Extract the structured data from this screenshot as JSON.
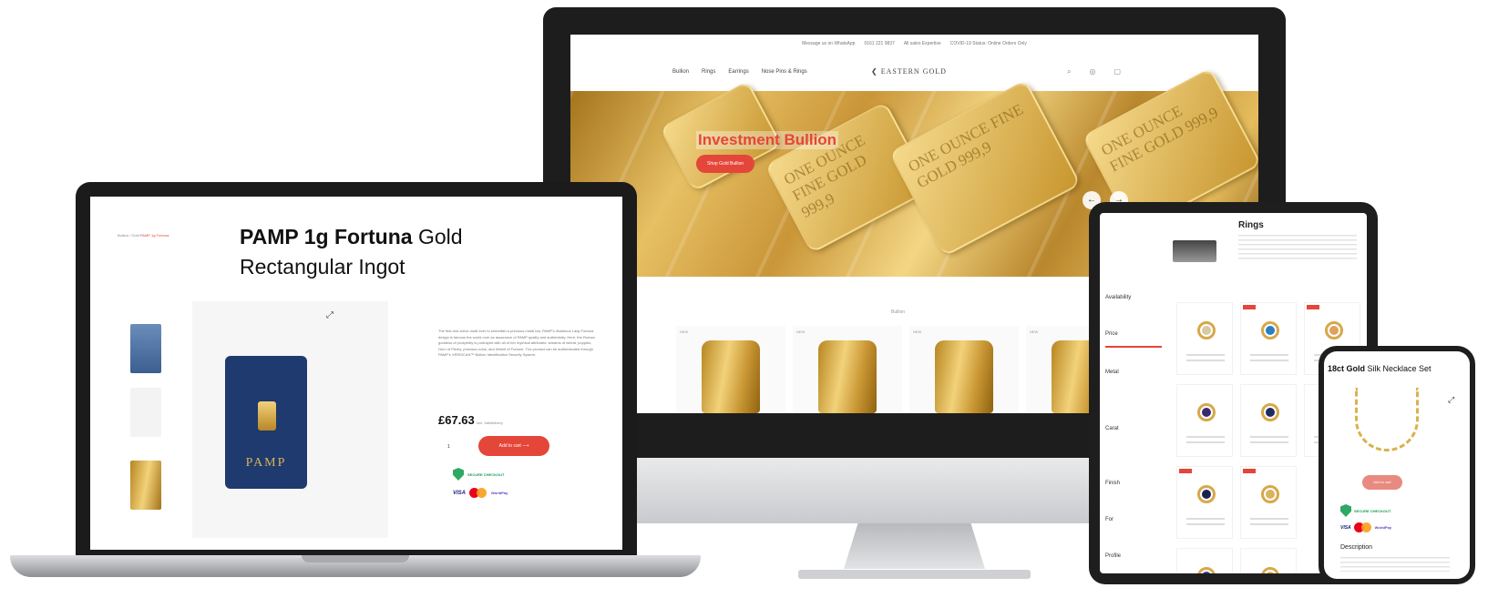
{
  "imac": {
    "topbar": [
      "Message us on WhatsApp",
      "0161 221 9837",
      "All sales Expertise",
      "COVID-19 Status: Online Orders Only"
    ],
    "nav_links": [
      "Bullion",
      "Rings",
      "Earrings",
      "Nose Pins & Rings"
    ],
    "logo": "EASTERN GOLD",
    "nav_icons": [
      "search-icon",
      "user-icon",
      "bag-icon"
    ],
    "hero_title": "Investment Bullion",
    "hero_button": "Shop Gold Bullion",
    "prev_arrow": "←",
    "next_arrow": "→",
    "bar_text": "ONE OUNCE FINE GOLD 999,9",
    "section_label": "Bullion",
    "card_tags": [
      "NEW",
      "NEW",
      "NEW",
      "NEW"
    ]
  },
  "laptop": {
    "breadcrumb_home": "Bullion / Gold",
    "breadcrumb_current": "PAMP 1g Fortuna",
    "title_bold": "PAMP 1g Fortuna",
    "title_rest": " Gold",
    "title_line2": "Rectangular Ingot",
    "expand_icon": "⤢",
    "pamp_brand": "PAMP",
    "description": "The first and arrive-motif ever to embellish a precious metal bar, PAMP's illustrious Lady Fortuna design is famous the world over as assurance of PAMP quality and authenticity. Here, the Roman goddess of prosperity is portrayed with all of her mythical attributes: streams of wheat, poppies, Horn of Plenty, precious coins, and Wheel of Fortune. The product can be authenticated through PAMP's VERISCAN™ Bullion Identification Security System.",
    "price": "£67.63",
    "price_note": "Incl. Vat/delivery",
    "qty": "1",
    "add_to_cart": "Add to cart  ⟶",
    "secure": "SECURE CHECKOUT",
    "pay_visa": "VISA",
    "pay_wp": "WorldPay"
  },
  "tablet": {
    "title": "Rings",
    "filters": {
      "availability": "Availability",
      "price": "Price",
      "metal": "Metal",
      "carat": "Carat",
      "finish": "Finish",
      "for": "For",
      "profile": "Profile"
    }
  },
  "phone": {
    "title_bold": "18ct Gold",
    "title_rest": " Silk Necklace Set",
    "expand_icon": "⤢",
    "button": "Add to cart",
    "secure": "SECURE CHECKOUT",
    "pay_visa": "VISA",
    "pay_wp": "WorldPay",
    "description": "Description"
  },
  "colors": {
    "accent": "#e4463a",
    "gold": "#e7c064",
    "pamp_blue": "#1e3a6e",
    "secure_green": "#1d9a56"
  }
}
